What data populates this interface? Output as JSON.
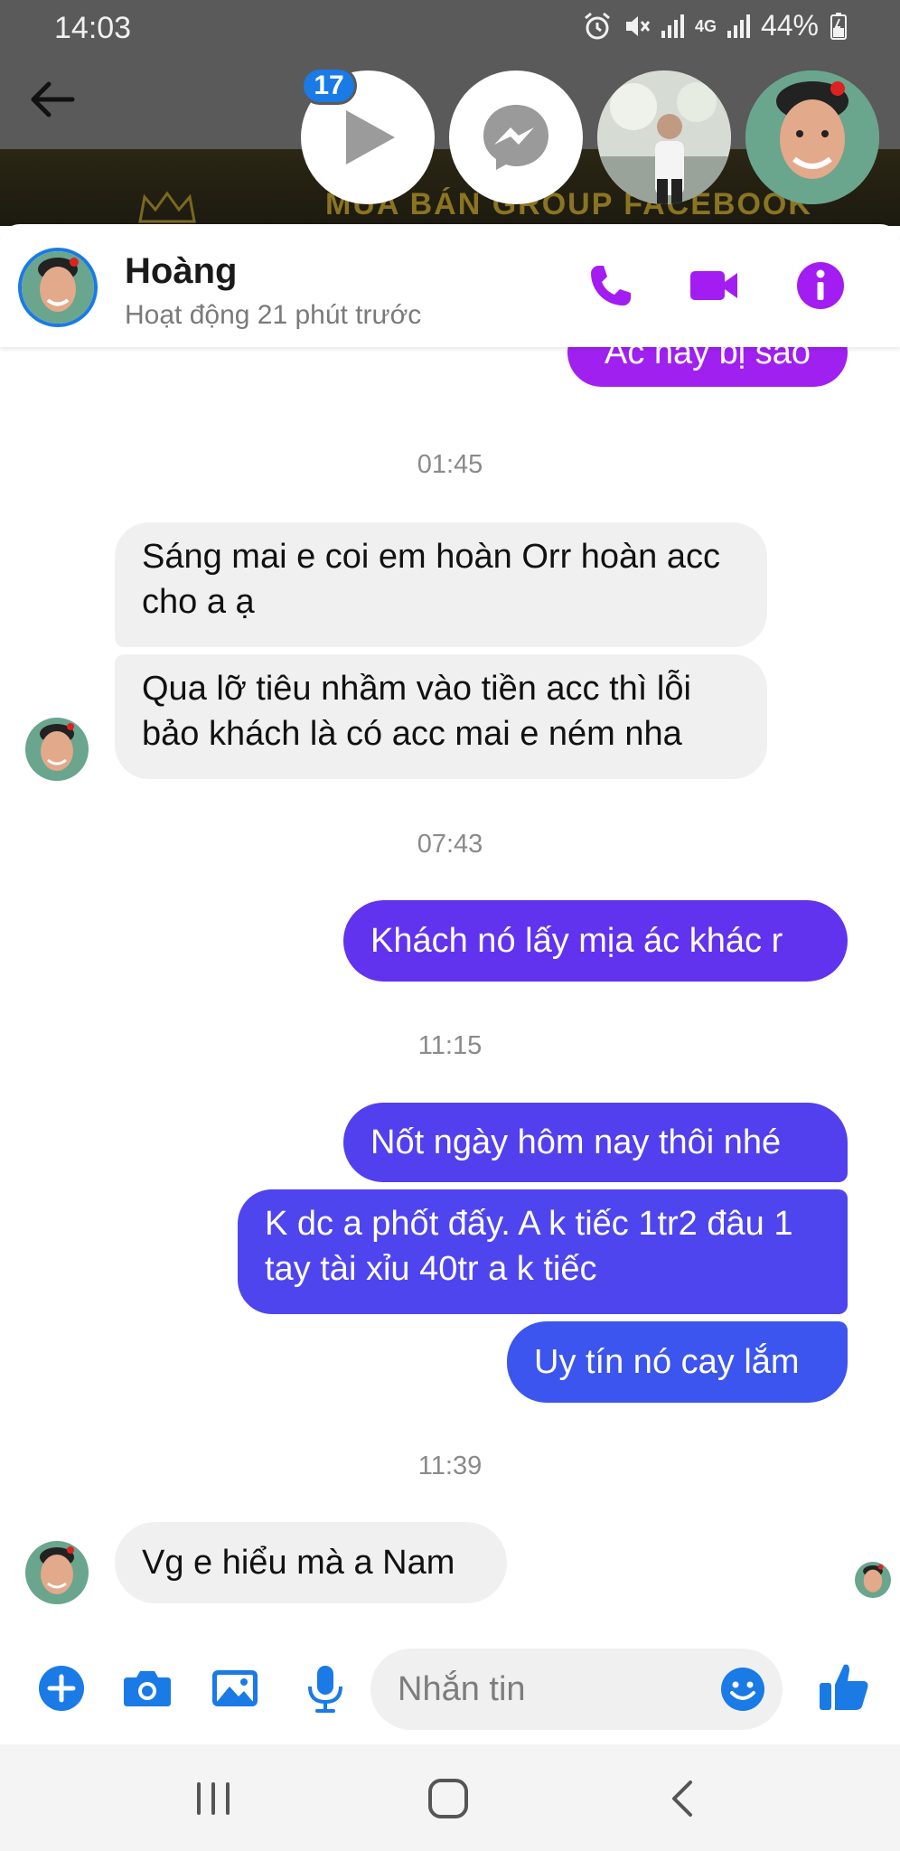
{
  "status_bar": {
    "time": "14:03",
    "network": "4G",
    "battery": "44%"
  },
  "chat_heads": {
    "badge_count": "17"
  },
  "banner": {
    "text": "MUA BÁN GROUP FACEBOOK"
  },
  "header": {
    "name": "Hoàng",
    "status": "Hoạt động 21 phút trước"
  },
  "messages": [
    {
      "type": "out",
      "text": "Ác này bị sao",
      "color": "#a020f0"
    },
    {
      "type": "time",
      "text": "01:45"
    },
    {
      "type": "in",
      "text": "Sáng mai e coi em hoàn Orr hoàn acc cho a ạ"
    },
    {
      "type": "in",
      "text": "Qua lỡ tiêu nhầm vào tiền acc thì lỗi bảo khách là có acc mai e ném nha"
    },
    {
      "type": "time",
      "text": "07:43"
    },
    {
      "type": "out",
      "text": "Khách nó lấy mịa ác khác r",
      "color": "#6233ee"
    },
    {
      "type": "time",
      "text": "11:15"
    },
    {
      "type": "out",
      "text": "Nốt ngày hôm nay thôi nhé",
      "color": "#5240ef"
    },
    {
      "type": "out",
      "text": "K dc a phốt đấy. A k tiếc 1tr2 đâu 1 tay tài xỉu 40tr a k tiếc",
      "color": "#4f45ef"
    },
    {
      "type": "out",
      "text": "Uy tín nó cay lắm",
      "color": "#3c55ee"
    },
    {
      "type": "time",
      "text": "11:39"
    },
    {
      "type": "in",
      "text": "Vg e hiểu mà a Nam"
    }
  ],
  "composer": {
    "placeholder": "Nhắn tin"
  },
  "colors": {
    "accent_purple": "#a31cf2",
    "messenger_blue": "#1a7ae6"
  }
}
